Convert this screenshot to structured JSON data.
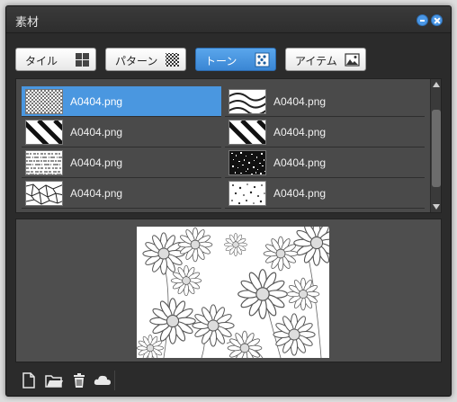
{
  "window": {
    "title": "素材"
  },
  "tabs": [
    {
      "label": "タイル",
      "icon": "tile-grid-icon",
      "active": false
    },
    {
      "label": "パターン",
      "icon": "pattern-checker-icon",
      "active": false
    },
    {
      "label": "トーン",
      "icon": "tone-dots-icon",
      "active": true
    },
    {
      "label": "アイテム",
      "icon": "item-image-icon",
      "active": false
    }
  ],
  "materials": {
    "left": [
      {
        "filename": "A0404.png",
        "texture": "checker",
        "selected": true
      },
      {
        "filename": "A0404.png",
        "texture": "diagonal-thick",
        "selected": false
      },
      {
        "filename": "A0404.png",
        "texture": "horizontal-noise",
        "selected": false
      },
      {
        "filename": "A0404.png",
        "texture": "cracked",
        "selected": false
      }
    ],
    "right": [
      {
        "filename": "A0404.png",
        "texture": "wavy",
        "selected": false
      },
      {
        "filename": "A0404.png",
        "texture": "diagonal-thick",
        "selected": false
      },
      {
        "filename": "A0404.png",
        "texture": "dense-noise",
        "selected": false
      },
      {
        "filename": "A0404.png",
        "texture": "sparse-dots",
        "selected": false
      }
    ]
  },
  "preview": {
    "subject": "daisy-flower-line-art"
  },
  "toolbar": [
    {
      "name": "new-file-icon"
    },
    {
      "name": "open-folder-icon"
    },
    {
      "name": "trash-icon"
    },
    {
      "name": "cloud-icon"
    }
  ],
  "colors": {
    "accent": "#4a97e0",
    "window_bg": "#2b2b2b",
    "panel_bg": "#4a4a4a"
  }
}
